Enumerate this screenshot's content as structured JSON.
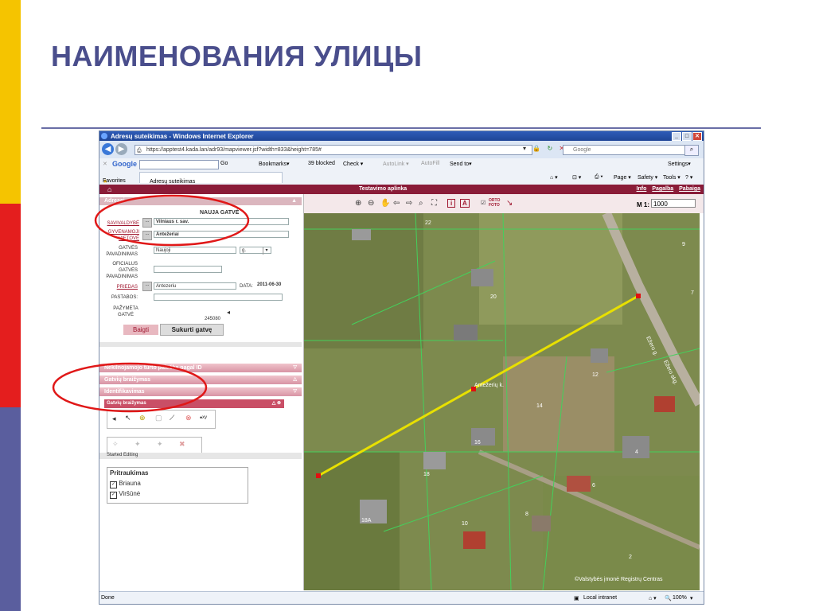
{
  "slide": {
    "title": "НАИМЕНОВАНИЯ УЛИЦЫ"
  },
  "browser": {
    "window_title": "Adresų suteikimas - Windows Internet Explorer",
    "url": "https://apptest4.kada.lan/adr93/mapviewer.jsf?width=833&height=785#",
    "search_placeholder": "Google",
    "google_toolbar": {
      "brand": "Google",
      "go": "Go",
      "bookmarks": "Bookmarks▾",
      "blocked": "39 blocked",
      "check": "Check ▾",
      "autolink": "AutoLink ▾",
      "autofill": "AutoFill",
      "sendto": "Send to▾",
      "settings": "Settings▾"
    },
    "favorites": "Favorites",
    "tab": "Adresų suteikimas",
    "command_bar": [
      "Page ▾",
      "Safety ▾",
      "Tools ▾",
      "? ▾"
    ],
    "status": {
      "left": "Done",
      "zone": "Local intranet",
      "zoom": "100%"
    }
  },
  "app": {
    "header_center": "Testavimo aplinka",
    "header_links": [
      "Info",
      "Pagalba",
      "Pabaiga"
    ],
    "panel_title": "Adresai",
    "form": {
      "title": "NAUJA GATVĖ",
      "savivaldybe_label": "SAVIVALDYBĖ",
      "savivaldybe_value": "Vilniaus r. sav.",
      "vietove_label": "GYVENAMOJI VIETOVĖ",
      "vietove_value": "Antežeriai",
      "pavadinimas_label": "GATVĖS PAVADINIMAS",
      "pavadinimas_value": "Naujoji",
      "tipas_value": "g.",
      "oficialus_label": "OFICIALUS GATVĖS PAVADINIMAS",
      "priedas_label": "PRIEDAS",
      "priedas_value": "Antezeriu",
      "data_label": "DATA:",
      "data_value": "2011-06-30",
      "pastabos_label": "PASTABOS:",
      "pazymeta_label": "PAŽYMĖTA GATVĖ",
      "pazymeta_value": "245080",
      "baigti": "Baigti",
      "sukurti": "Sukurti gatvę"
    },
    "sections": [
      "Nekilnojamojo turto paieška pagal ID",
      "Gatvių braižymas",
      "Identifikavimas"
    ],
    "sub_panel_title": "Gatvių braižymas",
    "started_editing": "Started Editing",
    "snapping": {
      "title": "Pritraukimas",
      "items": [
        {
          "label": "Briauna",
          "checked": true
        },
        {
          "label": "Viršūnė",
          "checked": true
        }
      ]
    },
    "map_toolbar": {
      "orto_foto": "ORTO FOTO",
      "scale_label": "M 1:",
      "scale_value": "1000"
    },
    "map": {
      "parcel_numbers": [
        "22",
        "9",
        "7",
        "20",
        "12",
        "14",
        "16",
        "4",
        "18",
        "6",
        "18A",
        "10",
        "8",
        "2"
      ],
      "street_labels": [
        "Antežerių k.",
        "Ežero g.",
        "Ežero skg."
      ],
      "copyright": "©Valstybės įmonė Registrų Centras",
      "highlight_color": "#e8e000"
    }
  }
}
